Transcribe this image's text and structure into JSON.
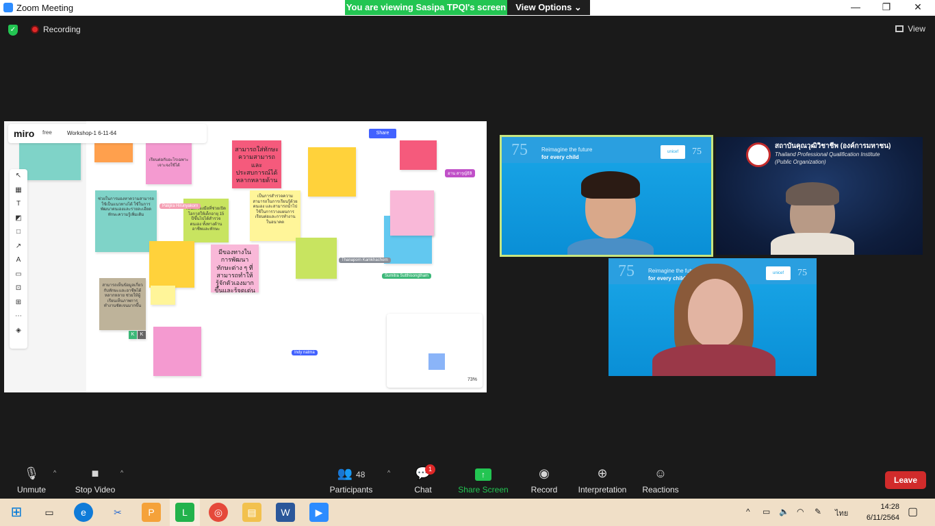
{
  "window": {
    "title": "Zoom Meeting",
    "minimize": "—",
    "restore": "❐",
    "close": "✕"
  },
  "banner": {
    "viewing": "You are viewing Sasipa TPQI's screen",
    "view_options": "View Options ⌄"
  },
  "status": {
    "recording": "Recording",
    "view": "View"
  },
  "miro": {
    "logo": "miro",
    "plan": "free",
    "board": "Workshop-1 6-11-64",
    "share": "Share",
    "zoom": "73%",
    "tools": [
      "↖",
      "▦",
      "T",
      "◩",
      "□",
      "↗",
      "A",
      "▭",
      "⊡",
      "⊞",
      "⋯",
      "◈"
    ],
    "notes": {
      "big1": "สามารถใส่ทักษะความสามารถและประสบการณ์ได้หลากหลายด้าน",
      "big2": "มีของทางในการพัฒนาทักษะต่าง ๆ ที่สามารถทำให้รู้จักตัวเองมากขึ้นและรู้จุดเด่นจุดด้อยของตัวเอง",
      "pink_top": "เรียนต่อกับอะไรเฉพาะเจาะจงใช้ได้",
      "teal": "ช่วยในการมองหาความสามารถ ใช้เป็นแนวทางได้ ใช้ในการพัฒนาตนเองและรายละเอียดทักษะความรู้เพิ่มเติม",
      "green": "เป็นเครื่องมือที่ช่วยเปิดโอกาสให้เด็กอายุ 15 ปีขึ้นไปได้สำรวจตนเอง ทั้งทางด้านอาชีพและทักษะ",
      "yellow2": "เป็นการสำรวจความสามารถในการเรียนรู้ด้วยตนเอง และสามารถนำไปใช้ในการวางแผนการเรียนต่อและการทำงานในอนาคต",
      "grey": "สามารถเห็นข้อมูลเกี่ยวกับทักษะและอาชีพได้หลากหลาย ช่วยให้ผู้เรียนเห็นภาพการทำงานชัดเจนมากขึ้น",
      "grey_avatar": "K",
      "grey_avatar2": "K"
    },
    "cursors": [
      {
        "name": "Pakjira Hirunyakorn",
        "color": "#f5a0b5"
      },
      {
        "name": "Thanaporn Kamkhachorn",
        "color": "#8a8f98"
      },
      {
        "name": "Sumitra Sutthisongtham",
        "color": "#3cb878"
      },
      {
        "name": "Indy natma",
        "color": "#4262ff"
      },
      {
        "name": "ฮาน สารุญ์ธิลิ",
        "color": "#c050c8"
      }
    ]
  },
  "videos": {
    "unicef_n75": "75",
    "tag1": "Reimagine the future",
    "tag2": "for every child",
    "brand": "unicef",
    "brand75": "75",
    "tpqi_l1": "สถาบันคุณวุฒิวิชาชีพ (องค์การมหาชน)",
    "tpqi_l2": "Thailand Professional Qualification Institute",
    "tpqi_l3": "(Public Organization)"
  },
  "toolbar": {
    "unmute": "Unmute",
    "stop_video": "Stop Video",
    "participants": "Participants",
    "participants_count": "48",
    "chat": "Chat",
    "chat_badge": "1",
    "share_screen": "Share Screen",
    "record": "Record",
    "interpretation": "Interpretation",
    "reactions": "Reactions",
    "leave": "Leave"
  },
  "taskbar": {
    "time": "14:28",
    "date": "6/11/2564",
    "lang": "ไทย"
  }
}
